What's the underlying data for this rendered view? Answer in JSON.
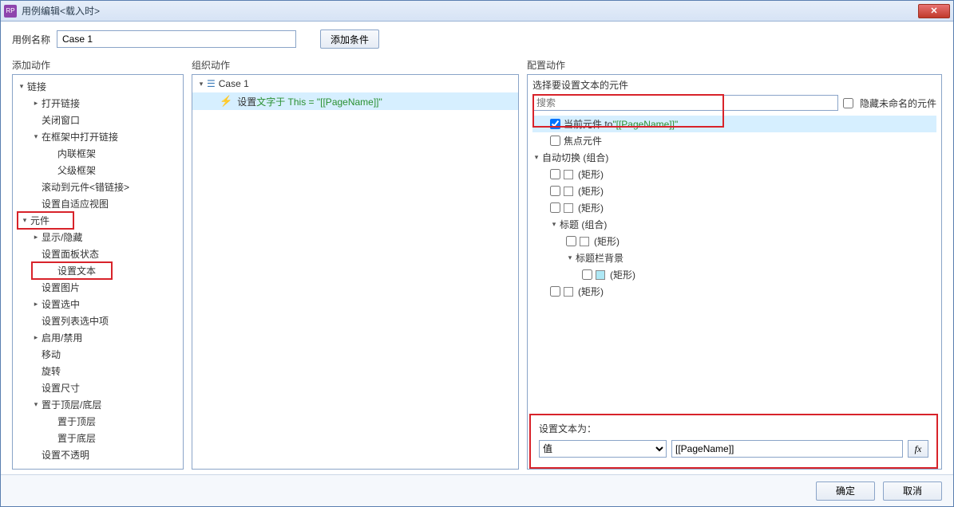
{
  "window": {
    "title": "用例编辑<载入时>",
    "icon_text": "RP"
  },
  "case_name_label": "用例名称",
  "case_name_value": "Case 1",
  "add_condition_label": "添加条件",
  "col_headers": {
    "add_action": "添加动作",
    "org_action": "组织动作",
    "config_action": "配置动作"
  },
  "left_tree": {
    "links": "链接",
    "open_link": "打开链接",
    "close_window": "关闭窗口",
    "open_in_frame": "在框架中打开链接",
    "inline_frame": "内联框架",
    "parent_frame": "父级框架",
    "scroll_to_anchor": "滚动到元件<错链接>",
    "set_adaptive_view": "设置自适应视图",
    "widgets": "元件",
    "show_hide": "显示/隐藏",
    "set_panel_state": "设置面板状态",
    "set_text": "设置文本",
    "set_image": "设置图片",
    "set_selected": "设置选中",
    "set_list_selected": "设置列表选中项",
    "enable_disable": "启用/禁用",
    "move": "移动",
    "rotate": "旋转",
    "set_size": "设置尺寸",
    "bring_front_back": "置于顶层/底层",
    "bring_front": "置于顶层",
    "send_back": "置于底层",
    "set_opacity": "设置不透明"
  },
  "mid": {
    "case_label": "Case 1",
    "set_prefix": "设置",
    "set_green": " 文字于 This = \"[[PageName]]\""
  },
  "right": {
    "head": "选择要设置文本的元件",
    "search_placeholder": "搜索",
    "hide_unnamed": "隐藏未命名的元件",
    "items": {
      "current_prefix": "当前元件 to ",
      "current_value": "\"[[PageName]]\"",
      "focus_widget": "焦点元件",
      "auto_switch_group": "自动切换 (组合)",
      "rect": "(矩形)",
      "title_group": "标题 (组合)",
      "titlebar_bg": "标题栏背景"
    },
    "set_text_label": "设置文本为：",
    "dropdown_value": "值",
    "text_value": "[[PageName]]",
    "fx_label": "fx"
  },
  "footer": {
    "ok": "确定",
    "cancel": "取消"
  }
}
